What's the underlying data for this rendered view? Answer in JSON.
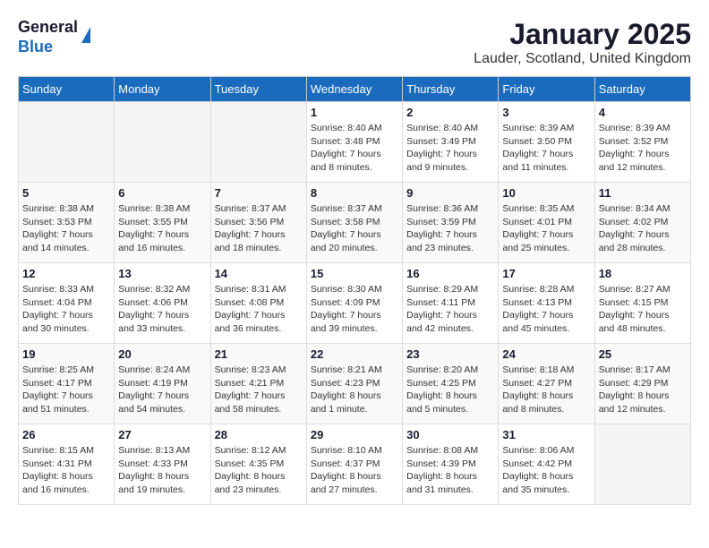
{
  "header": {
    "logo_general": "General",
    "logo_blue": "Blue",
    "month_title": "January 2025",
    "location": "Lauder, Scotland, United Kingdom"
  },
  "days_of_week": [
    "Sunday",
    "Monday",
    "Tuesday",
    "Wednesday",
    "Thursday",
    "Friday",
    "Saturday"
  ],
  "weeks": [
    [
      {
        "day": "",
        "info": ""
      },
      {
        "day": "",
        "info": ""
      },
      {
        "day": "",
        "info": ""
      },
      {
        "day": "1",
        "info": "Sunrise: 8:40 AM\nSunset: 3:48 PM\nDaylight: 7 hours\nand 8 minutes."
      },
      {
        "day": "2",
        "info": "Sunrise: 8:40 AM\nSunset: 3:49 PM\nDaylight: 7 hours\nand 9 minutes."
      },
      {
        "day": "3",
        "info": "Sunrise: 8:39 AM\nSunset: 3:50 PM\nDaylight: 7 hours\nand 11 minutes."
      },
      {
        "day": "4",
        "info": "Sunrise: 8:39 AM\nSunset: 3:52 PM\nDaylight: 7 hours\nand 12 minutes."
      }
    ],
    [
      {
        "day": "5",
        "info": "Sunrise: 8:38 AM\nSunset: 3:53 PM\nDaylight: 7 hours\nand 14 minutes."
      },
      {
        "day": "6",
        "info": "Sunrise: 8:38 AM\nSunset: 3:55 PM\nDaylight: 7 hours\nand 16 minutes."
      },
      {
        "day": "7",
        "info": "Sunrise: 8:37 AM\nSunset: 3:56 PM\nDaylight: 7 hours\nand 18 minutes."
      },
      {
        "day": "8",
        "info": "Sunrise: 8:37 AM\nSunset: 3:58 PM\nDaylight: 7 hours\nand 20 minutes."
      },
      {
        "day": "9",
        "info": "Sunrise: 8:36 AM\nSunset: 3:59 PM\nDaylight: 7 hours\nand 23 minutes."
      },
      {
        "day": "10",
        "info": "Sunrise: 8:35 AM\nSunset: 4:01 PM\nDaylight: 7 hours\nand 25 minutes."
      },
      {
        "day": "11",
        "info": "Sunrise: 8:34 AM\nSunset: 4:02 PM\nDaylight: 7 hours\nand 28 minutes."
      }
    ],
    [
      {
        "day": "12",
        "info": "Sunrise: 8:33 AM\nSunset: 4:04 PM\nDaylight: 7 hours\nand 30 minutes."
      },
      {
        "day": "13",
        "info": "Sunrise: 8:32 AM\nSunset: 4:06 PM\nDaylight: 7 hours\nand 33 minutes."
      },
      {
        "day": "14",
        "info": "Sunrise: 8:31 AM\nSunset: 4:08 PM\nDaylight: 7 hours\nand 36 minutes."
      },
      {
        "day": "15",
        "info": "Sunrise: 8:30 AM\nSunset: 4:09 PM\nDaylight: 7 hours\nand 39 minutes."
      },
      {
        "day": "16",
        "info": "Sunrise: 8:29 AM\nSunset: 4:11 PM\nDaylight: 7 hours\nand 42 minutes."
      },
      {
        "day": "17",
        "info": "Sunrise: 8:28 AM\nSunset: 4:13 PM\nDaylight: 7 hours\nand 45 minutes."
      },
      {
        "day": "18",
        "info": "Sunrise: 8:27 AM\nSunset: 4:15 PM\nDaylight: 7 hours\nand 48 minutes."
      }
    ],
    [
      {
        "day": "19",
        "info": "Sunrise: 8:25 AM\nSunset: 4:17 PM\nDaylight: 7 hours\nand 51 minutes."
      },
      {
        "day": "20",
        "info": "Sunrise: 8:24 AM\nSunset: 4:19 PM\nDaylight: 7 hours\nand 54 minutes."
      },
      {
        "day": "21",
        "info": "Sunrise: 8:23 AM\nSunset: 4:21 PM\nDaylight: 7 hours\nand 58 minutes."
      },
      {
        "day": "22",
        "info": "Sunrise: 8:21 AM\nSunset: 4:23 PM\nDaylight: 8 hours\nand 1 minute."
      },
      {
        "day": "23",
        "info": "Sunrise: 8:20 AM\nSunset: 4:25 PM\nDaylight: 8 hours\nand 5 minutes."
      },
      {
        "day": "24",
        "info": "Sunrise: 8:18 AM\nSunset: 4:27 PM\nDaylight: 8 hours\nand 8 minutes."
      },
      {
        "day": "25",
        "info": "Sunrise: 8:17 AM\nSunset: 4:29 PM\nDaylight: 8 hours\nand 12 minutes."
      }
    ],
    [
      {
        "day": "26",
        "info": "Sunrise: 8:15 AM\nSunset: 4:31 PM\nDaylight: 8 hours\nand 16 minutes."
      },
      {
        "day": "27",
        "info": "Sunrise: 8:13 AM\nSunset: 4:33 PM\nDaylight: 8 hours\nand 19 minutes."
      },
      {
        "day": "28",
        "info": "Sunrise: 8:12 AM\nSunset: 4:35 PM\nDaylight: 8 hours\nand 23 minutes."
      },
      {
        "day": "29",
        "info": "Sunrise: 8:10 AM\nSunset: 4:37 PM\nDaylight: 8 hours\nand 27 minutes."
      },
      {
        "day": "30",
        "info": "Sunrise: 8:08 AM\nSunset: 4:39 PM\nDaylight: 8 hours\nand 31 minutes."
      },
      {
        "day": "31",
        "info": "Sunrise: 8:06 AM\nSunset: 4:42 PM\nDaylight: 8 hours\nand 35 minutes."
      },
      {
        "day": "",
        "info": ""
      }
    ]
  ]
}
